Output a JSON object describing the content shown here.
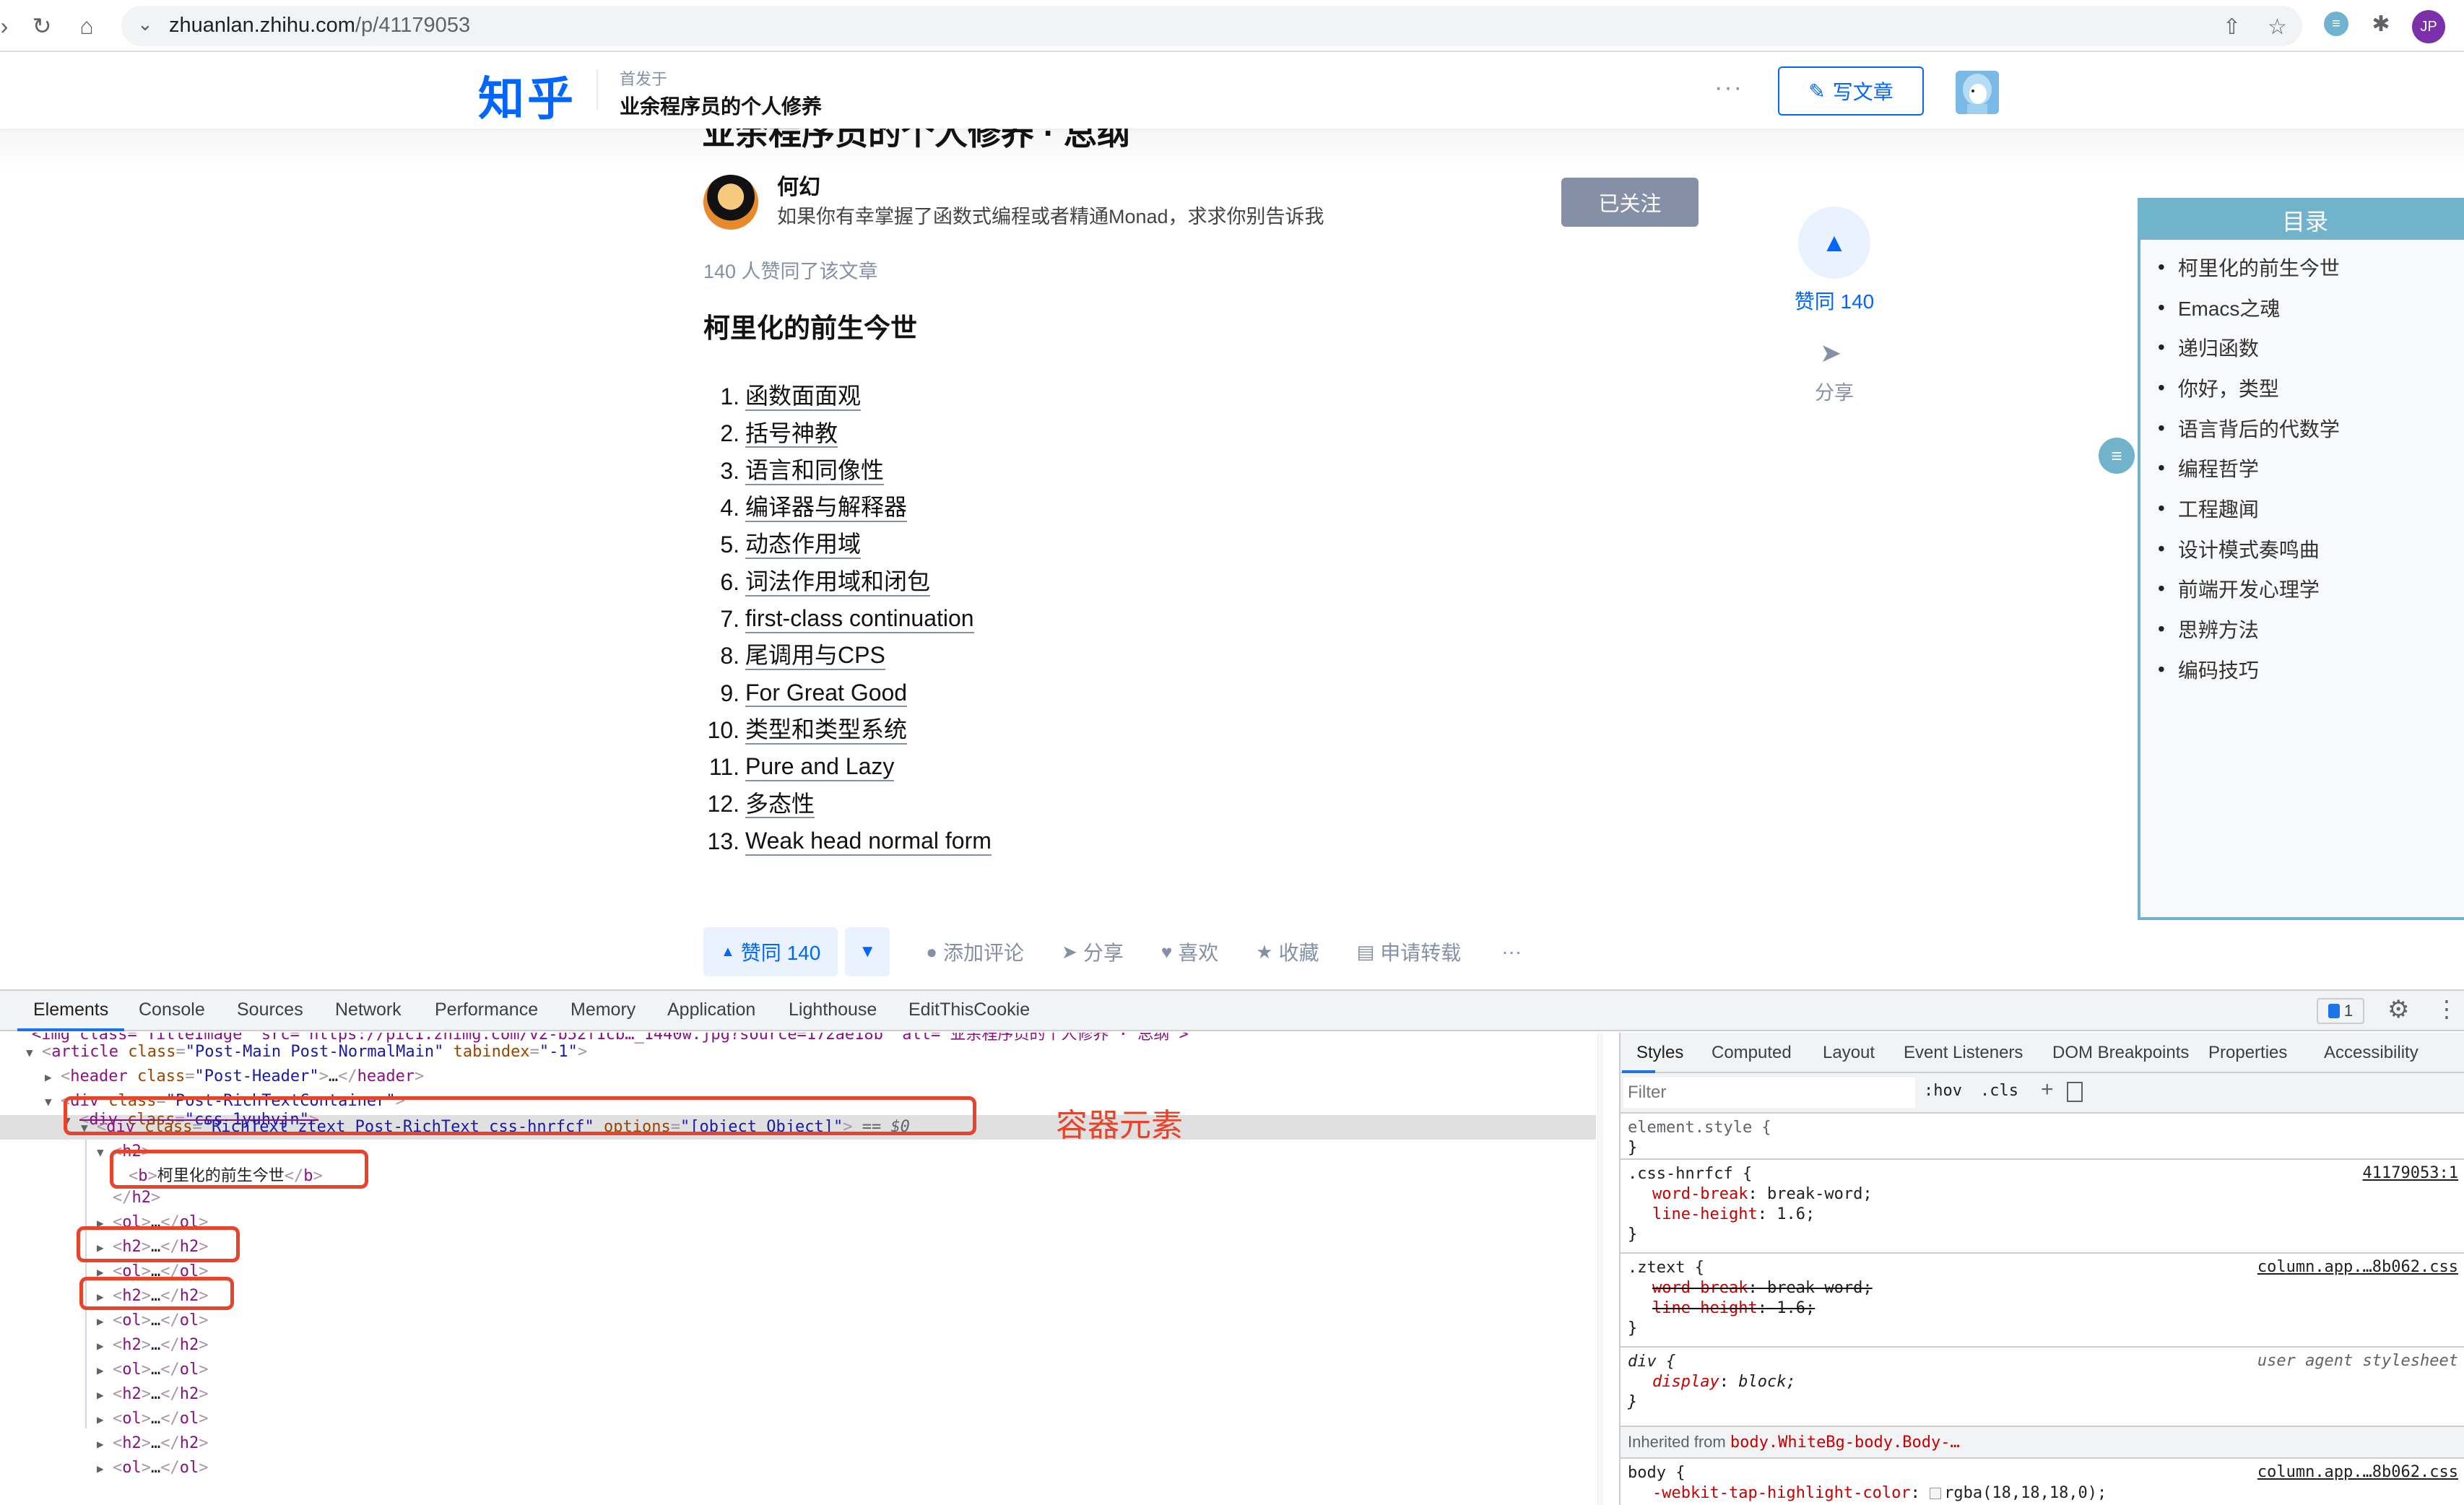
{
  "browser": {
    "url_host": "zhuanlan.zhihu.com",
    "url_path": "/p/41179053",
    "profile_initials": "JP",
    "icons": [
      "reload-icon",
      "home-icon",
      "share-icon",
      "bookmark-star-icon",
      "extension-icon",
      "puzzle-icon"
    ]
  },
  "header": {
    "logo": "知乎",
    "first_published": "首发于",
    "column_name": "业余程序员的个人修养",
    "more": "···",
    "write_article": "写文章"
  },
  "article": {
    "title_partial": "业余程序员的个人修养 · 总纲",
    "author": {
      "name": "何幻",
      "bio": "如果你有幸掌握了函数式编程或者精通Monad，求求你别告诉我",
      "follow_label": "已关注"
    },
    "approve_summary": "140 人赞同了该文章",
    "section_heading": "柯里化的前生今世",
    "toc": [
      {
        "num": "1.",
        "label": "函数面面观"
      },
      {
        "num": "2.",
        "label": "括号神教"
      },
      {
        "num": "3.",
        "label": "语言和同像性"
      },
      {
        "num": "4.",
        "label": "编译器与解释器"
      },
      {
        "num": "5.",
        "label": "动态作用域"
      },
      {
        "num": "6.",
        "label": "词法作用域和闭包"
      },
      {
        "num": "7.",
        "label": "first-class continuation"
      },
      {
        "num": "8.",
        "label": "尾调用与CPS"
      },
      {
        "num": "9.",
        "label": "For Great Good"
      },
      {
        "num": "10.",
        "label": "类型和类型系统"
      },
      {
        "num": "11.",
        "label": "Pure and Lazy"
      },
      {
        "num": "12.",
        "label": "多态性"
      },
      {
        "num": "13.",
        "label": "Weak head normal form"
      }
    ]
  },
  "side_actions": {
    "vote_label": "赞同 140",
    "share_label": "分享"
  },
  "catalog": {
    "title": "目录",
    "items": [
      "柯里化的前生今世",
      "Emacs之魂",
      "递归函数",
      "你好，类型",
      "语言背后的代数学",
      "编程哲学",
      "工程趣闻",
      "设计模式奏鸣曲",
      "前端开发心理学",
      "思辨方法",
      "编码技巧"
    ]
  },
  "action_bar": {
    "vote_up": "赞同 140",
    "comment": "添加评论",
    "share": "分享",
    "like": "喜欢",
    "collect": "收藏",
    "repost": "申请转载",
    "more": "···"
  },
  "devtools": {
    "tabs": [
      "Elements",
      "Console",
      "Sources",
      "Network",
      "Performance",
      "Memory",
      "Application",
      "Lighthouse",
      "EditThisCookie"
    ],
    "active_tab": "Elements",
    "issues_count": "1",
    "dom": {
      "line0": "<img class=\"TitleImage\" src=\"https://pic1.zhimg.com/v2-b52f1cb…_1440w.jpg?source=172ae18b\" alt=\"业余程序员的个人修养 · 总纲\">",
      "article_tag": "article",
      "article_class": "Post-Main Post-NormalMain",
      "article_tabindex": "-1",
      "header_class": "Post-Header",
      "container_class": "Post-RichTextContainer",
      "inner_class": "css-1yuhvjn",
      "richtext_class": "RichText ztext Post-RichText css-hnrfcf",
      "richtext_options": "[object Object]",
      "selected_marker": "== $0",
      "h2_bold_text": "柯里化的前生今世",
      "collapsed_children": [
        "ol",
        "h2",
        "ol",
        "h2",
        "ol",
        "h2",
        "ol",
        "h2",
        "ol",
        "h2",
        "ol"
      ]
    },
    "annotation_label": "容器元素",
    "styles": {
      "tabs": [
        "Styles",
        "Computed",
        "Layout",
        "Event Listeners",
        "DOM Breakpoints",
        "Properties",
        "Accessibility"
      ],
      "active_tab": "Styles",
      "filter_placeholder": "Filter",
      "hov": ":hov",
      "cls": ".cls",
      "rules": [
        {
          "selector": "element.style {",
          "source": "",
          "props": []
        },
        {
          "selector": ".css-hnrfcf {",
          "source": "41179053:1",
          "props": [
            {
              "name": "word-break",
              "value": "break-word;"
            },
            {
              "name": "line-height",
              "value": "1.6;"
            }
          ]
        },
        {
          "selector": ".ztext {",
          "source": "column.app.…8b062.css",
          "props": [
            {
              "name": "word-break",
              "value": "break-word;"
            },
            {
              "name": "line-height",
              "value": "1.6;"
            }
          ]
        },
        {
          "selector": "div {",
          "source": "user agent stylesheet",
          "props": [
            {
              "name": "display",
              "value": "block;"
            }
          ]
        },
        {
          "selector": "body {",
          "source": "column.app.…8b062.css",
          "props": [
            {
              "name": "-webkit-tap-highlight-color",
              "value": "rgba(18,18,18,0);"
            }
          ]
        }
      ],
      "inherited_prefix": "Inherited from",
      "inherited_selector": "body.WhiteBg-body.Body-…"
    }
  },
  "colors": {
    "zhihu_blue": "#0066ff",
    "muted_gray": "#8590a6",
    "catalog_teal": "#72b3cc",
    "annotation_red": "#e8432b",
    "devtools_blue": "#1a73e8"
  }
}
